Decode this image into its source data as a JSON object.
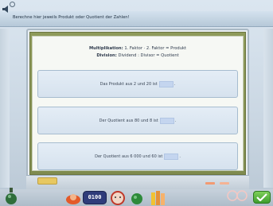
{
  "instruction": "Berechne hier jeweils Produkt oder Quotient der Zahlen!",
  "rules": {
    "multiplication_label": "Multiplikation:",
    "multiplication_text": "1. Faktor · 2. Faktor = Produkt",
    "division_label": "Division:",
    "division_text": "Dividend : Divisor = Quotient"
  },
  "tasks": [
    {
      "text": "Das Produkt aus 2 und 20 ist",
      "answer": "",
      "suffix": "."
    },
    {
      "text": "Der Quotient aus 80 und 8 ist",
      "answer": "",
      "suffix": "."
    },
    {
      "text": "Der Quotient aus 6 000 und 60 ist",
      "answer": "",
      "suffix": "."
    }
  ],
  "toolbar": {
    "score_display": "0100"
  },
  "colors": {
    "board": "#8e9a5a",
    "answer_field": "#c4d5ef",
    "check_button": "#3e9d2d"
  }
}
